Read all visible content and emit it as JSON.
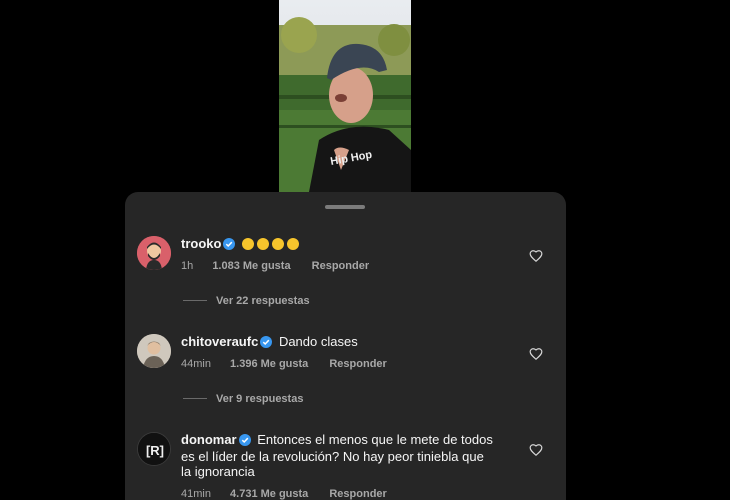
{
  "comments": [
    {
      "username": "trooko",
      "text": "",
      "emojis": [
        "astonished",
        "laughing",
        "hand-over-mouth",
        "neutral"
      ],
      "time": "1h",
      "likes": "1.083 Me gusta",
      "reply": "Responder",
      "view_replies": "Ver 22 respuestas"
    },
    {
      "username": "chitoveraufc",
      "text": "Dando clases",
      "time": "44min",
      "likes": "1.396 Me gusta",
      "reply": "Responder",
      "view_replies": "Ver 9 respuestas"
    },
    {
      "username": "donomar",
      "text_lines": [
        "Entonces el menos que le mete de todos",
        "es el líder de la revolución? No hay peor tiniebla que",
        "la ignorancia"
      ],
      "time": "41min",
      "likes": "4.731 Me gusta",
      "reply": "Responder"
    }
  ],
  "avatars": {
    "trooko": {
      "bg": "#d9606a",
      "icon": "bearded-man-avatar"
    },
    "chitoveraufc": {
      "bg": "#cfc8bd",
      "icon": "man-photo-avatar"
    },
    "donomar": {
      "bg": "#111111",
      "icon": "r-logo-avatar",
      "logo_text": "[R]"
    }
  },
  "colors": {
    "sheet": "#262626",
    "verified": "#3897f0",
    "muted": "#a8a8a8"
  }
}
